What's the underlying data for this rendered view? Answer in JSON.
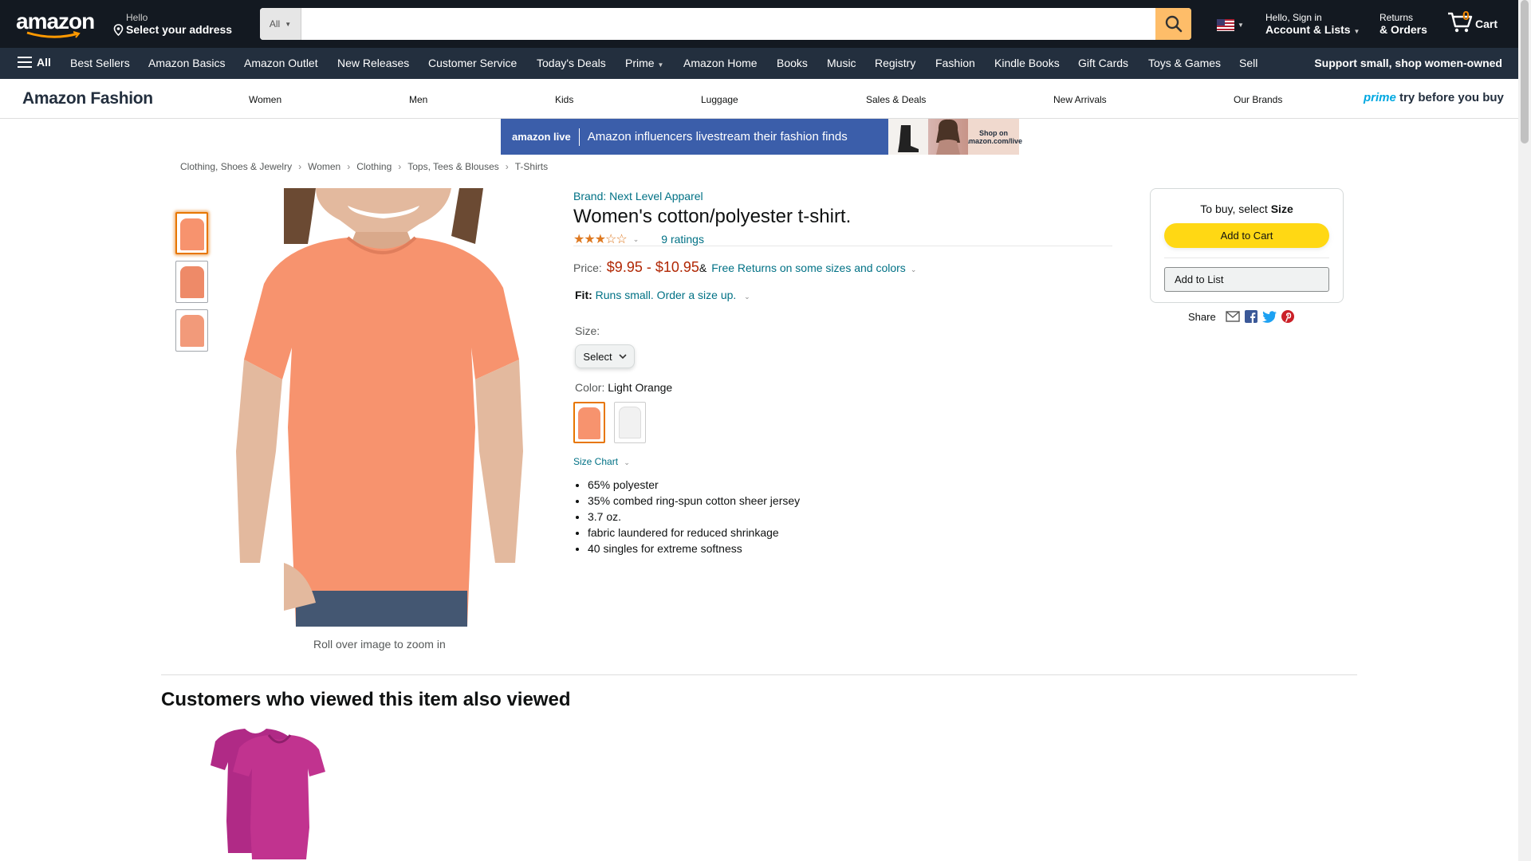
{
  "header": {
    "logo_text": "amazon",
    "location_small": "Hello",
    "location_big": "Select your address",
    "search_category": "All",
    "search_placeholder": "",
    "account_small": "Hello, Sign in",
    "account_big": "Account & Lists",
    "returns_small": "Returns",
    "returns_big": "& Orders",
    "cart_count": "0",
    "cart_label": "Cart"
  },
  "subnav": {
    "all_label": "All",
    "items": [
      "Best Sellers",
      "Amazon Basics",
      "Amazon Outlet",
      "New Releases",
      "Customer Service",
      "Today's Deals",
      "Prime",
      "Amazon Home",
      "Books",
      "Music",
      "Registry",
      "Fashion",
      "Kindle Books",
      "Gift Cards",
      "Toys & Games",
      "Sell"
    ],
    "support_label": "Support small, shop women-owned"
  },
  "fashion": {
    "brand": "Amazon Fashion",
    "links": [
      "Women",
      "Men",
      "Kids",
      "Luggage",
      "Sales & Deals",
      "New Arrivals",
      "Our Brands"
    ],
    "prime_word": "prime",
    "prime_rest": "try before you buy"
  },
  "banner": {
    "logo": "amazon live",
    "text": "Amazon influencers livestream their fashion finds",
    "shop": "Shop on amazon.com/live"
  },
  "breadcrumb": [
    "Clothing, Shoes & Jewelry",
    "Women",
    "Clothing",
    "Tops, Tees & Blouses",
    "T-Shirts"
  ],
  "product": {
    "brand_link": "Brand: Next Level Apparel",
    "title": "Women's cotton/polyester t-shirt.",
    "stars": "★★★☆☆",
    "rating_value": 3,
    "ratings_count": "9 ratings",
    "price_label": "Price:",
    "price_value": "$9.95 - $10.95",
    "price_amp": "&",
    "free_returns": "Free Returns on some sizes and colors",
    "fit_label": "Fit:",
    "fit_value": "Runs small. Order a size up.",
    "size_label": "Size:",
    "size_select": "Select",
    "color_label": "Color:",
    "color_value": "Light Orange",
    "size_chart": "Size Chart",
    "bullets": [
      "65% polyester",
      "35% combed ring-spun cotton sheer jersey",
      "3.7 oz.",
      "fabric laundered for reduced shrinkage",
      "40 singles for extreme softness"
    ],
    "zoom_hint": "Roll over image to zoom in"
  },
  "colors": {
    "shirt": "#f7936e",
    "white_swatch": "#f1f1f1",
    "link": "#007185",
    "price": "#b12704",
    "addcart": "#ffd814"
  },
  "buybox": {
    "to_buy": "To buy, select",
    "to_buy_bold": "Size",
    "add_to_cart": "Add to Cart",
    "add_to_list": "Add to List",
    "share": "Share"
  },
  "also_viewed": {
    "heading": "Customers who viewed this item also viewed"
  }
}
